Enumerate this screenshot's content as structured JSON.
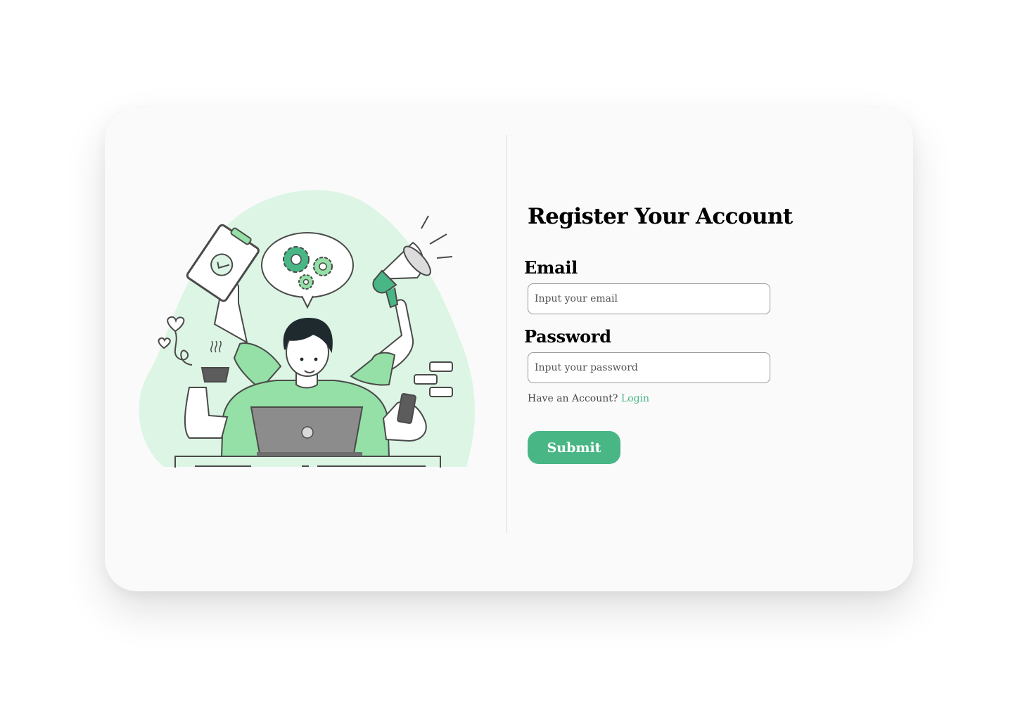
{
  "colors": {
    "accent": "#49b685",
    "blob": "#ddf5e4",
    "shirt": "#94e0a6",
    "laptop": "#8c8c8c",
    "outline": "#4a4a4a"
  },
  "illustration": {
    "name": "multitasking-person-illustration"
  },
  "form": {
    "title": "Register Your Account",
    "email_label": "Email",
    "email_placeholder": "Input your email",
    "email_value": "",
    "password_label": "Password",
    "password_placeholder": "Input your password",
    "password_value": "",
    "have_account_text": "Have an Account?",
    "login_link": "Login",
    "submit_label": "Submit"
  }
}
